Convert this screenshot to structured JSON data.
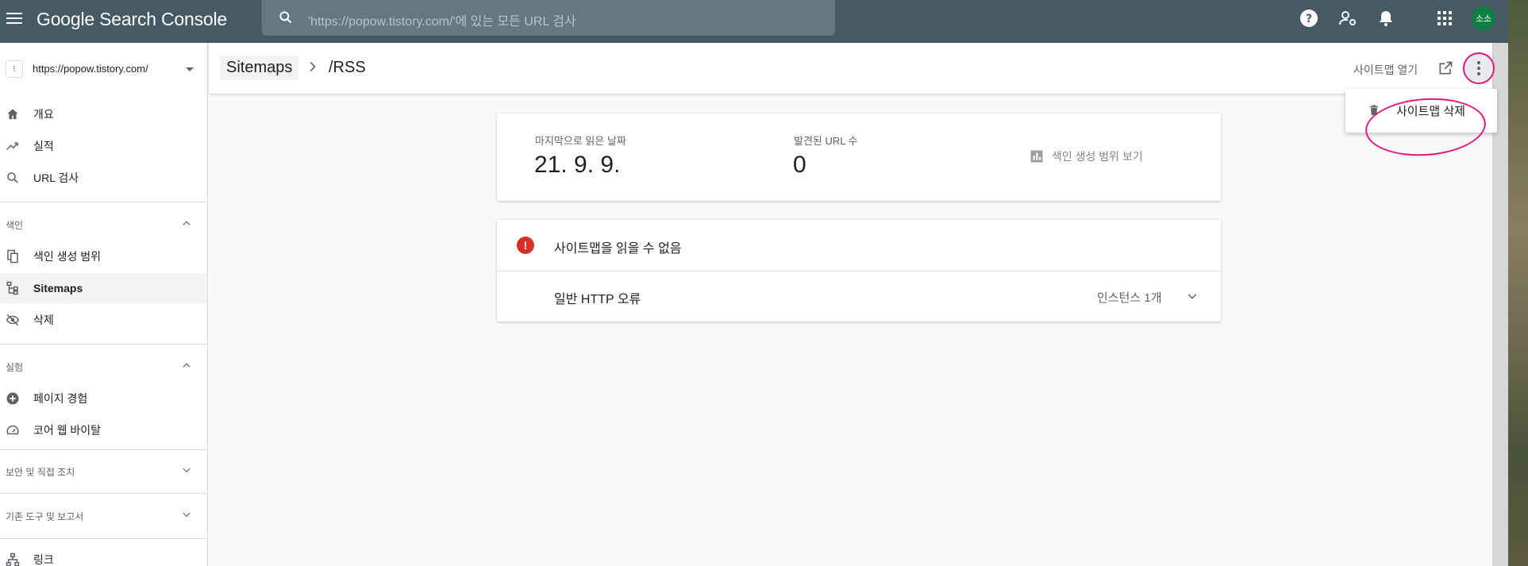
{
  "topbar": {
    "brand": "Google Search Console",
    "search_placeholder": "'https://popow.tistory.com/'에 있는 모든 URL 검사",
    "avatar_text": "소소"
  },
  "property": {
    "url": "https://popow.tistory.com/"
  },
  "sidebar": {
    "items_top": [
      {
        "label": "개요",
        "icon": "home-icon"
      },
      {
        "label": "실적",
        "icon": "trending-up-icon"
      },
      {
        "label": "URL 검사",
        "icon": "search-icon"
      }
    ],
    "sections": [
      {
        "label": "색인",
        "expanded": true,
        "items": [
          {
            "label": "색인 생성 범위",
            "icon": "file-copy-icon"
          },
          {
            "label": "Sitemaps",
            "icon": "sitemap-icon",
            "active": true
          },
          {
            "label": "삭제",
            "icon": "visibility-off-icon"
          }
        ]
      },
      {
        "label": "실험",
        "expanded": true,
        "items": [
          {
            "label": "페이지 경험",
            "icon": "add-circle-icon"
          },
          {
            "label": "코어 웹 바이탈",
            "icon": "speed-icon"
          }
        ]
      },
      {
        "label": "보안 및 직접 조치",
        "expanded": false
      },
      {
        "label": "기존 도구 및 보고서",
        "expanded": false
      }
    ],
    "bottom_item": {
      "label": "링크",
      "icon": "links-icon"
    }
  },
  "header": {
    "crumb_root": "Sitemaps",
    "crumb_current": "/RSS",
    "open_sitemap": "사이트맵 열기"
  },
  "menu": {
    "delete_label": "사이트맵 삭제"
  },
  "summary": {
    "last_read_label": "마지막으로 읽은 날짜",
    "last_read_value": "21. 9. 9.",
    "found_urls_label": "발견된 URL 수",
    "found_urls_value": "0",
    "coverage_link": "색인 생성 범위 보기"
  },
  "error_card": {
    "title": "사이트맵을 읽을 수 없음",
    "row_label": "일반 HTTP 오류",
    "row_count": "인스턴스 1개"
  },
  "colors": {
    "topbar": "#455a64",
    "error": "#d93025",
    "annotation": "#e3177f",
    "avatar": "#0b8043"
  }
}
